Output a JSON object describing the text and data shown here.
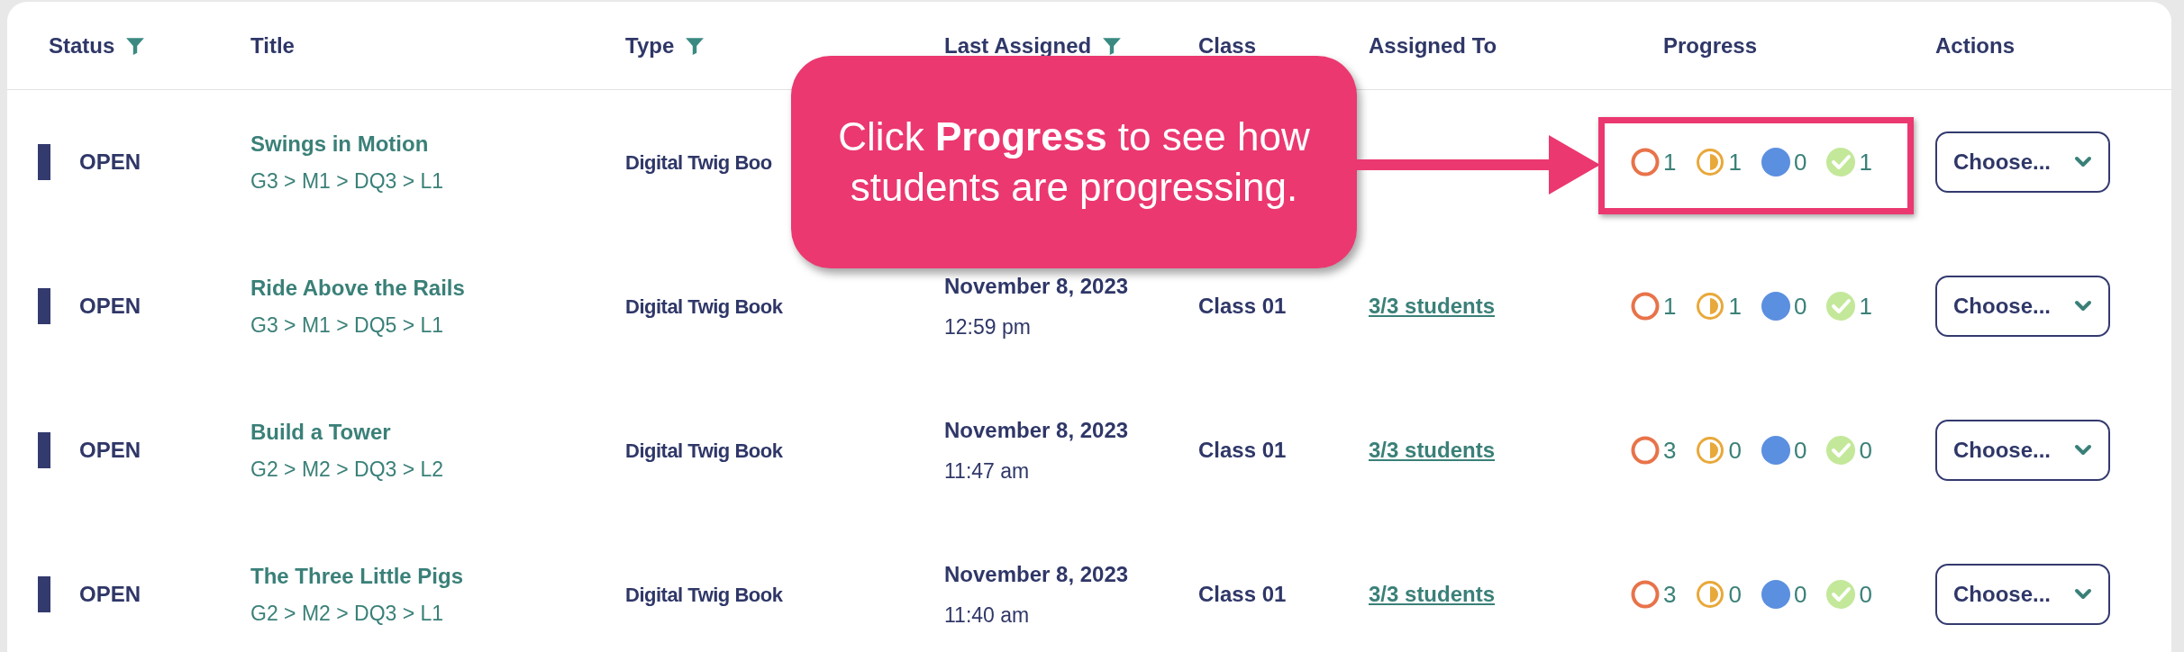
{
  "columns": [
    {
      "label": "Status",
      "filter": true
    },
    {
      "label": "Title",
      "filter": false
    },
    {
      "label": "Type",
      "filter": true
    },
    {
      "label": "Last Assigned",
      "filter": true
    },
    {
      "label": "Class",
      "filter": false
    },
    {
      "label": "Assigned To",
      "filter": false
    },
    {
      "label": "Progress",
      "filter": false
    },
    {
      "label": "Actions",
      "filter": false
    }
  ],
  "rows": [
    {
      "status": "OPEN",
      "title": "Swings in Motion",
      "path": "G3 > M1 > DQ3 > L1",
      "type": "Digital Twig Boo",
      "progress": [
        {
          "kind": "not-started",
          "count": "1"
        },
        {
          "kind": "in-progress",
          "count": "1"
        },
        {
          "kind": "submitted",
          "count": "0"
        },
        {
          "kind": "completed",
          "count": "1"
        }
      ],
      "action": "Choose..."
    },
    {
      "status": "OPEN",
      "title": "Ride Above the Rails",
      "path": "G3 > M1 > DQ5 > L1",
      "type": "Digital Twig Book",
      "date": "November 8, 2023",
      "time": "12:59 pm",
      "class": "Class 01",
      "assigned_to": "3/3 students",
      "progress": [
        {
          "kind": "not-started",
          "count": "1"
        },
        {
          "kind": "in-progress",
          "count": "1"
        },
        {
          "kind": "submitted",
          "count": "0"
        },
        {
          "kind": "completed",
          "count": "1"
        }
      ],
      "action": "Choose..."
    },
    {
      "status": "OPEN",
      "title": "Build a Tower",
      "path": "G2 > M2 > DQ3 > L2",
      "type": "Digital Twig Book",
      "date": "November 8, 2023",
      "time": "11:47 am",
      "class": "Class 01",
      "assigned_to": "3/3 students",
      "progress": [
        {
          "kind": "not-started",
          "count": "3"
        },
        {
          "kind": "in-progress",
          "count": "0"
        },
        {
          "kind": "submitted",
          "count": "0"
        },
        {
          "kind": "completed",
          "count": "0"
        }
      ],
      "action": "Choose..."
    },
    {
      "status": "OPEN",
      "title": "The Three Little Pigs",
      "path": "G2 > M2 > DQ3 > L1",
      "type": "Digital Twig Book",
      "date": "November 8, 2023",
      "time": "11:40 am",
      "class": "Class 01",
      "assigned_to": "3/3 students",
      "progress": [
        {
          "kind": "not-started",
          "count": "3"
        },
        {
          "kind": "in-progress",
          "count": "0"
        },
        {
          "kind": "submitted",
          "count": "0"
        },
        {
          "kind": "completed",
          "count": "0"
        }
      ],
      "action": "Choose..."
    }
  ],
  "callout": {
    "text": "Click **Progress** to see how students are progressing."
  }
}
